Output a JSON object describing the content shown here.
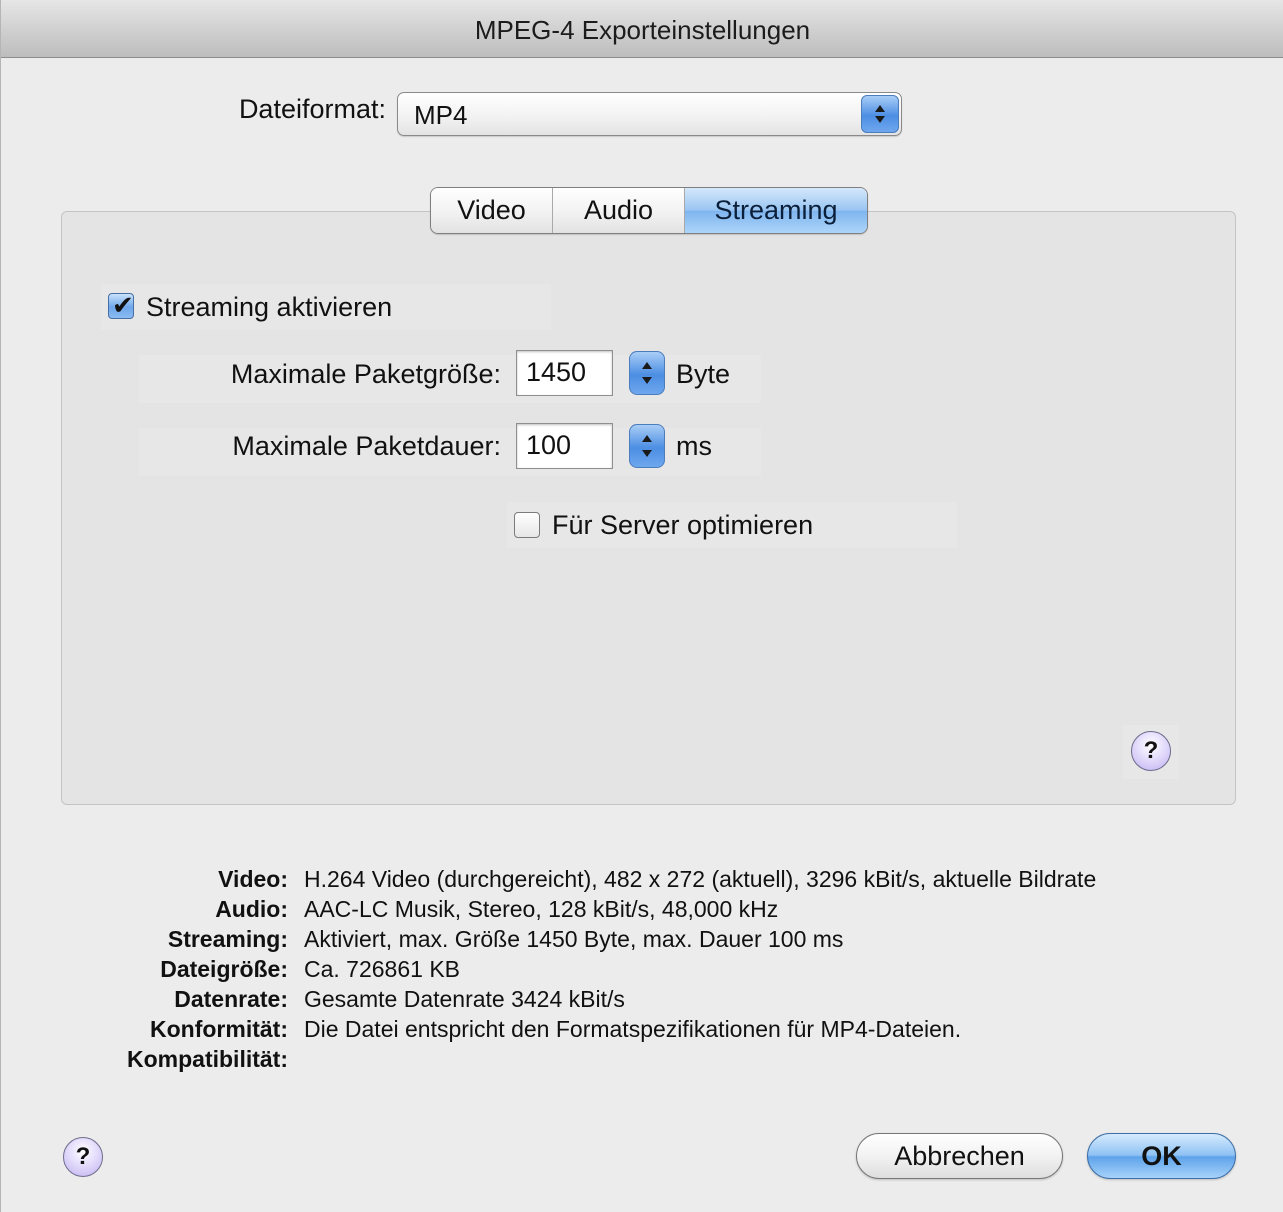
{
  "window": {
    "title": "MPEG-4 Exporteinstellungen"
  },
  "format": {
    "label": "Dateiformat:",
    "value": "MP4"
  },
  "tabs": [
    {
      "label": "Video",
      "active": false
    },
    {
      "label": "Audio",
      "active": false
    },
    {
      "label": "Streaming",
      "active": true
    }
  ],
  "streaming": {
    "enable_label": "Streaming aktivieren",
    "enable_checked": true,
    "packet_size_label": "Maximale Paketgröße:",
    "packet_size_value": "1450",
    "packet_size_unit": "Byte",
    "packet_duration_label": "Maximale Paketdauer:",
    "packet_duration_value": "100",
    "packet_duration_unit": "ms",
    "optimize_label": "Für Server optimieren",
    "optimize_checked": false
  },
  "summary": [
    {
      "key": "Video:",
      "value": "H.264 Video (durchgereicht), 482 x 272 (aktuell), 3296 kBit/s, aktuelle Bildrate"
    },
    {
      "key": "Audio:",
      "value": "AAC-LC Musik, Stereo, 128 kBit/s, 48,000 kHz"
    },
    {
      "key": "Streaming:",
      "value": "Aktiviert, max. Größe 1450 Byte, max. Dauer 100 ms"
    },
    {
      "key": "Dateigröße:",
      "value": "Ca. 726861 KB"
    },
    {
      "key": "Datenrate:",
      "value": "Gesamte Datenrate 3424 kBit/s"
    },
    {
      "key": "Konformität:",
      "value": "Die Datei entspricht den Formatspezifikationen für MP4-Dateien."
    },
    {
      "key": "Kompatibilität:",
      "value": ""
    }
  ],
  "buttons": {
    "cancel": "Abbrechen",
    "ok": "OK"
  },
  "help": {
    "glyph": "?"
  },
  "icons": {
    "checkmark": "✔",
    "stepper": "up-down-arrows-icon"
  },
  "colors": {
    "accent": "#5ea3ea",
    "tab_active": "#98c5f2",
    "help_fill": "#bfb0f0"
  }
}
